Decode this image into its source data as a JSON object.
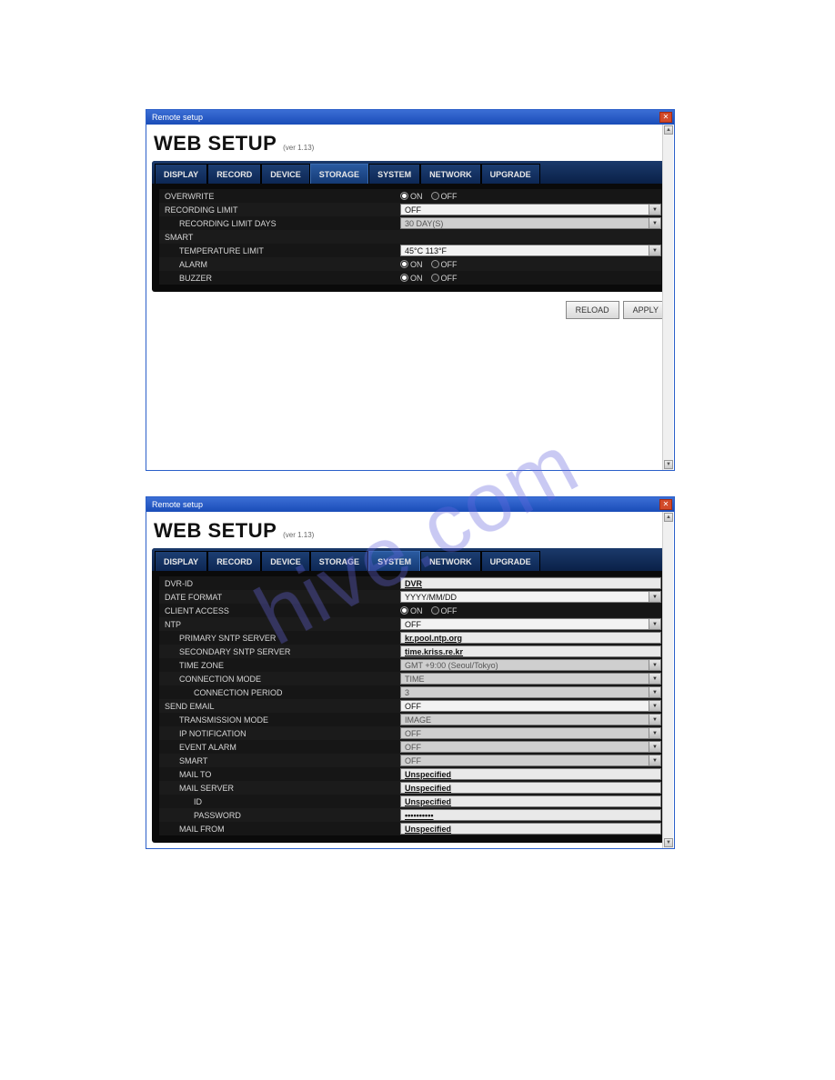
{
  "watermark": "hive.com",
  "titlebar": "Remote setup",
  "header": {
    "title": "WEB SETUP",
    "version": "(ver 1.13)"
  },
  "tabs": [
    "DISPLAY",
    "RECORD",
    "DEVICE",
    "STORAGE",
    "SYSTEM",
    "NETWORK",
    "UPGRADE"
  ],
  "buttons": {
    "reload": "RELOAD",
    "apply": "APPLY"
  },
  "radio": {
    "on": "ON",
    "off": "OFF"
  },
  "win1": {
    "active_tab": "STORAGE",
    "rows": {
      "overwrite": "OVERWRITE",
      "recording_limit": "RECORDING LIMIT",
      "recording_limit_days": "RECORDING LIMIT DAYS",
      "smart": "SMART",
      "temperature_limit": "TEMPERATURE LIMIT",
      "alarm": "ALARM",
      "buzzer": "BUZZER"
    },
    "values": {
      "overwrite": "ON",
      "recording_limit": "OFF",
      "recording_limit_days": "30 DAY(S)",
      "temperature_limit": "45°C 113°F",
      "alarm": "ON",
      "buzzer": "ON"
    }
  },
  "win2": {
    "active_tab": "SYSTEM",
    "rows": {
      "dvr_id": "DVR-ID",
      "date_format": "DATE FORMAT",
      "client_access": "CLIENT ACCESS",
      "ntp": "NTP",
      "primary_sntp": "PRIMARY SNTP SERVER",
      "secondary_sntp": "SECONDARY SNTP SERVER",
      "time_zone": "TIME ZONE",
      "connection_mode": "CONNECTION MODE",
      "connection_period": "CONNECTION PERIOD",
      "send_email": "SEND EMAIL",
      "transmission_mode": "TRANSMISSION MODE",
      "ip_notification": "IP NOTIFICATION",
      "event_alarm": "EVENT ALARM",
      "smart": "SMART",
      "mail_to": "MAIL TO",
      "mail_server": "MAIL SERVER",
      "id": "ID",
      "password": "PASSWORD",
      "mail_from": "MAIL FROM"
    },
    "values": {
      "dvr_id": "DVR",
      "date_format": "YYYY/MM/DD",
      "client_access": "ON",
      "ntp": "OFF",
      "primary_sntp": "kr.pool.ntp.org",
      "secondary_sntp": "time.kriss.re.kr",
      "time_zone": "GMT +9:00 (Seoul/Tokyo)",
      "connection_mode": "TIME",
      "connection_period": "3",
      "send_email": "OFF",
      "transmission_mode": "IMAGE",
      "ip_notification": "OFF",
      "event_alarm": "OFF",
      "smart": "OFF",
      "mail_to": "Unspecified",
      "mail_server": "Unspecified",
      "id": "Unspecified",
      "password": "••••••••••",
      "mail_from": "Unspecified"
    }
  }
}
